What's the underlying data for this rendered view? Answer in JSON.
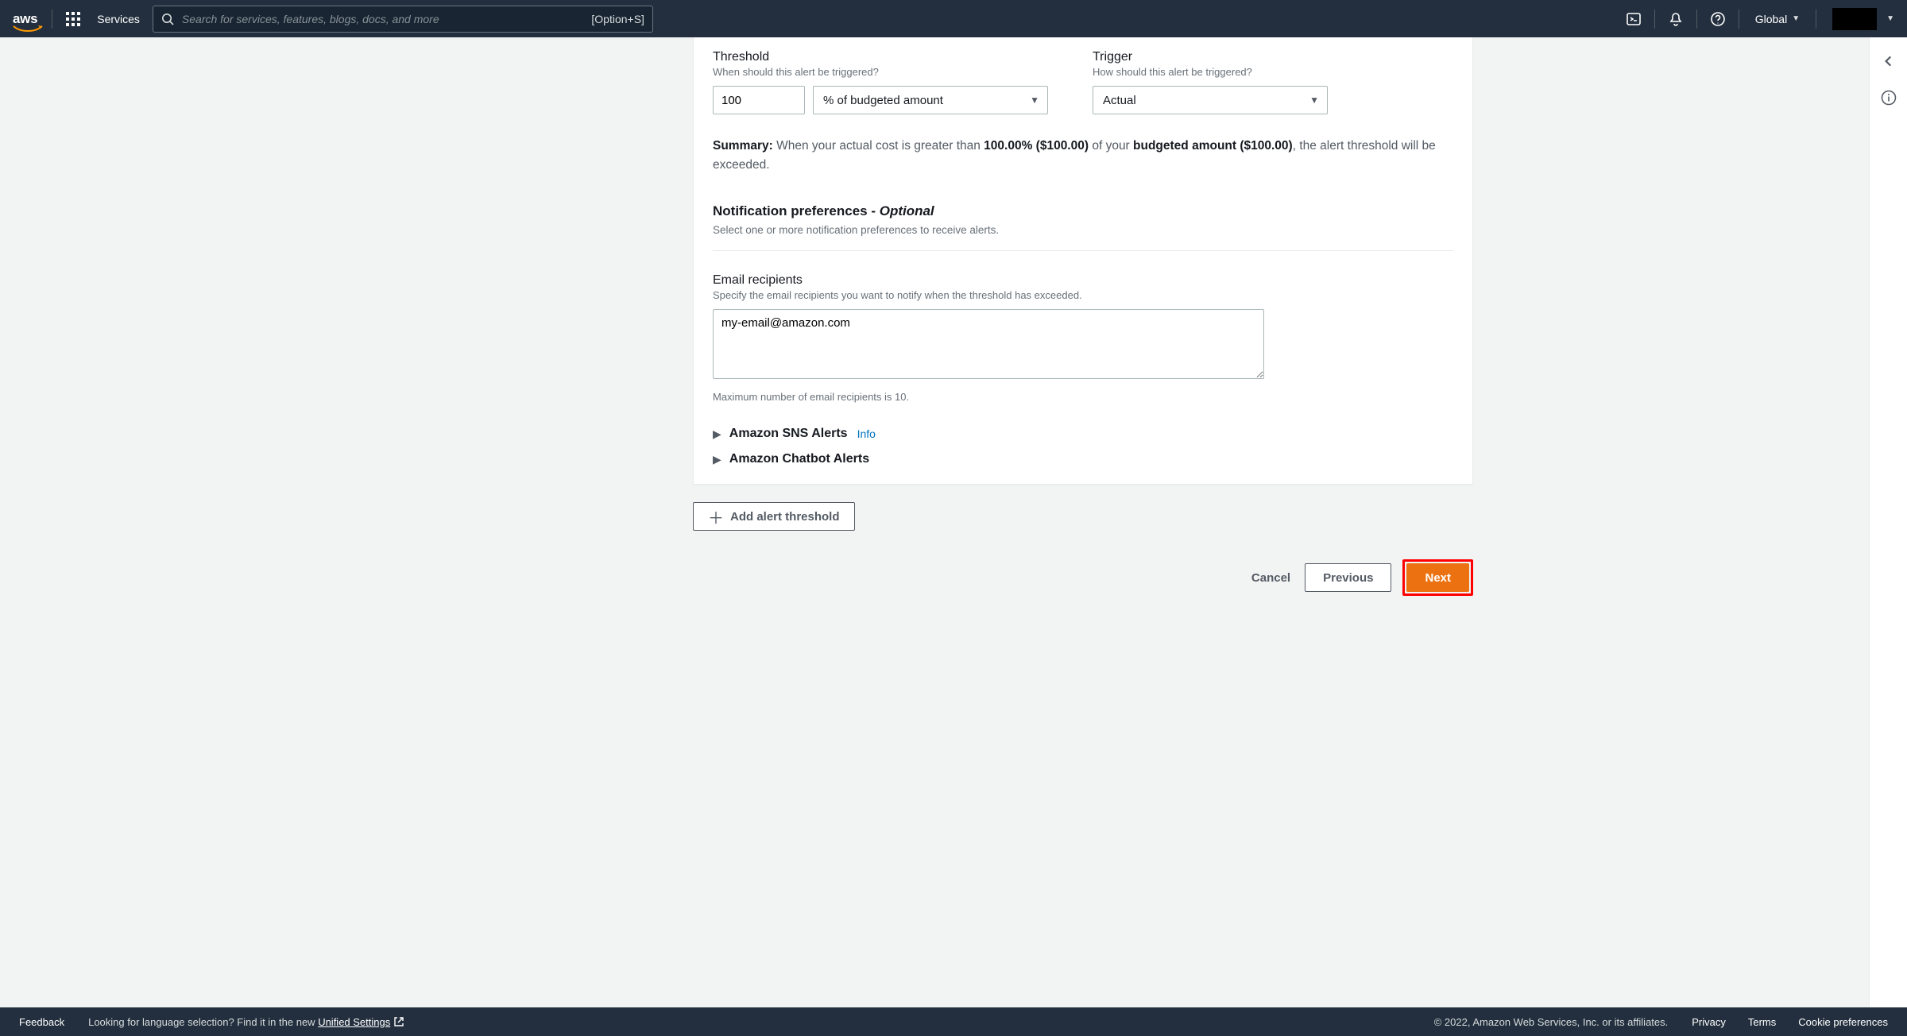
{
  "nav": {
    "services_label": "Services",
    "search_placeholder": "Search for services, features, blogs, docs, and more",
    "search_hint": "[Option+S]",
    "region_label": "Global"
  },
  "form": {
    "threshold": {
      "label": "Threshold",
      "help": "When should this alert be triggered?",
      "value": "100",
      "unit_label": "% of budgeted amount"
    },
    "trigger": {
      "label": "Trigger",
      "help": "How should this alert be triggered?",
      "value_label": "Actual"
    },
    "summary": {
      "prefix": "Summary:",
      "text_a": " When your actual cost is greater than ",
      "bold_a": "100.00% ($100.00)",
      "text_b": " of your ",
      "bold_b": "budgeted amount ($100.00)",
      "text_c": ", the alert threshold will be exceeded."
    },
    "notif": {
      "title_a": "Notification preferences - ",
      "title_b": "Optional",
      "desc": "Select one or more notification preferences to receive alerts."
    },
    "email": {
      "label": "Email recipients",
      "help": "Specify the email recipients you want to notify when the threshold has exceeded.",
      "value": "my-email@amazon.com",
      "hint": "Maximum number of email recipients is 10."
    },
    "expand_sns": {
      "title": "Amazon SNS Alerts",
      "info": "Info"
    },
    "expand_chatbot": {
      "title": "Amazon Chatbot Alerts"
    },
    "add_button": "Add alert threshold",
    "buttons": {
      "cancel": "Cancel",
      "previous": "Previous",
      "next": "Next"
    }
  },
  "footer": {
    "feedback": "Feedback",
    "lang_a": "Looking for language selection? Find it in the new ",
    "lang_link": "Unified Settings",
    "copy": "© 2022, Amazon Web Services, Inc. or its affiliates.",
    "privacy": "Privacy",
    "terms": "Terms",
    "cookie": "Cookie preferences"
  }
}
